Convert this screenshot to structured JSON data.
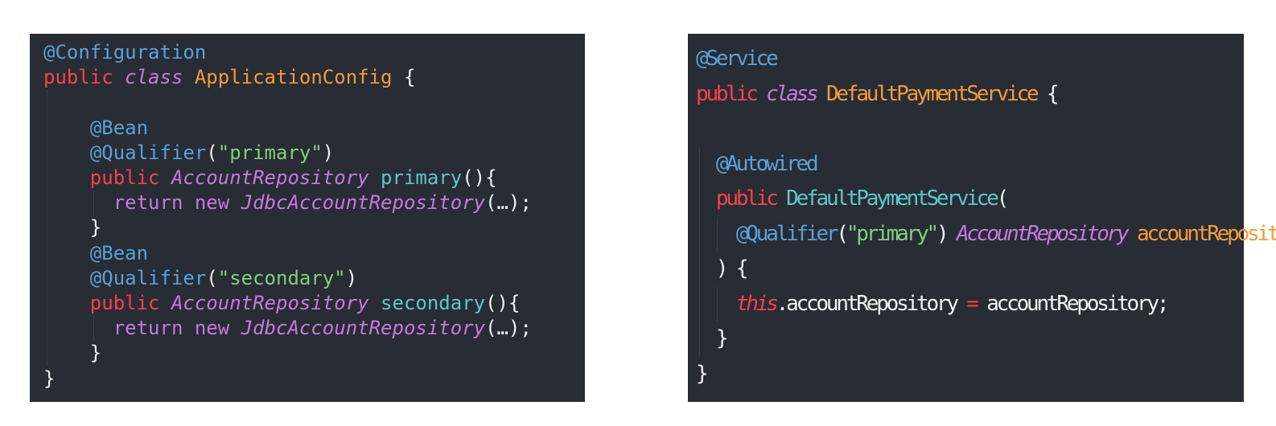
{
  "left_snippet": {
    "lines": [
      [
        {
          "t": "@Configuration",
          "c": "ann"
        }
      ],
      [
        {
          "t": "public",
          "c": "kw"
        },
        {
          "t": " ",
          "c": "plain"
        },
        {
          "t": "class",
          "c": "mod"
        },
        {
          "t": " ",
          "c": "plain"
        },
        {
          "t": "ApplicationConfig",
          "c": "cls"
        },
        {
          "t": " {",
          "c": "plain"
        }
      ],
      [],
      [
        {
          "t": "    ",
          "c": "plain"
        },
        {
          "t": "@Bean",
          "c": "ann"
        }
      ],
      [
        {
          "t": "    ",
          "c": "plain"
        },
        {
          "t": "@Qualifier",
          "c": "ann"
        },
        {
          "t": "(",
          "c": "plain"
        },
        {
          "t": "\"primary\"",
          "c": "str"
        },
        {
          "t": ")",
          "c": "plain"
        }
      ],
      [
        {
          "t": "    ",
          "c": "plain"
        },
        {
          "t": "public",
          "c": "kw"
        },
        {
          "t": " ",
          "c": "plain"
        },
        {
          "t": "AccountRepository",
          "c": "ty"
        },
        {
          "t": " ",
          "c": "plain"
        },
        {
          "t": "primary",
          "c": "fn"
        },
        {
          "t": "(){",
          "c": "plain"
        }
      ],
      [
        {
          "t": "      ",
          "c": "plain"
        },
        {
          "t": "return new",
          "c": "ret"
        },
        {
          "t": " ",
          "c": "plain"
        },
        {
          "t": "JdbcAccountRepository",
          "c": "ty"
        },
        {
          "t": "(…);",
          "c": "plain"
        }
      ],
      [
        {
          "t": "    }",
          "c": "plain"
        }
      ],
      [
        {
          "t": "    ",
          "c": "plain"
        },
        {
          "t": "@Bean",
          "c": "ann"
        }
      ],
      [
        {
          "t": "    ",
          "c": "plain"
        },
        {
          "t": "@Qualifier",
          "c": "ann"
        },
        {
          "t": "(",
          "c": "plain"
        },
        {
          "t": "\"secondary\"",
          "c": "str"
        },
        {
          "t": ")",
          "c": "plain"
        }
      ],
      [
        {
          "t": "    ",
          "c": "plain"
        },
        {
          "t": "public",
          "c": "kw"
        },
        {
          "t": " ",
          "c": "plain"
        },
        {
          "t": "AccountRepository",
          "c": "ty"
        },
        {
          "t": " ",
          "c": "plain"
        },
        {
          "t": "secondary",
          "c": "fn"
        },
        {
          "t": "(){",
          "c": "plain"
        }
      ],
      [
        {
          "t": "      ",
          "c": "plain"
        },
        {
          "t": "return new",
          "c": "ret"
        },
        {
          "t": " ",
          "c": "plain"
        },
        {
          "t": "JdbcAccountRepository",
          "c": "ty"
        },
        {
          "t": "(…);",
          "c": "plain"
        }
      ],
      [
        {
          "t": "    }",
          "c": "plain"
        }
      ],
      [
        {
          "t": "}",
          "c": "plain"
        }
      ]
    ]
  },
  "right_snippet": {
    "lines": [
      [
        {
          "t": "@Service",
          "c": "ann"
        }
      ],
      [
        {
          "t": "public",
          "c": "kw"
        },
        {
          "t": " ",
          "c": "plain"
        },
        {
          "t": "class",
          "c": "mod"
        },
        {
          "t": " ",
          "c": "plain"
        },
        {
          "t": "DefaultPaymentService",
          "c": "cls"
        },
        {
          "t": " {",
          "c": "plain"
        }
      ],
      [],
      [
        {
          "t": "  ",
          "c": "plain"
        },
        {
          "t": "@Autowired",
          "c": "ann"
        }
      ],
      [
        {
          "t": "  ",
          "c": "plain"
        },
        {
          "t": "public",
          "c": "kw"
        },
        {
          "t": " ",
          "c": "plain"
        },
        {
          "t": "DefaultPaymentService",
          "c": "fn"
        },
        {
          "t": "(",
          "c": "plain"
        }
      ],
      [
        {
          "t": "    ",
          "c": "plain"
        },
        {
          "t": "@Qualifier",
          "c": "ann"
        },
        {
          "t": "(",
          "c": "plain"
        },
        {
          "t": "\"primary\"",
          "c": "str"
        },
        {
          "t": ") ",
          "c": "plain"
        },
        {
          "t": "AccountRepository",
          "c": "ty"
        },
        {
          "t": " ",
          "c": "plain"
        },
        {
          "t": "accountRepository",
          "c": "param"
        }
      ],
      [
        {
          "t": "  ) {",
          "c": "plain"
        }
      ],
      [
        {
          "t": "    ",
          "c": "plain"
        },
        {
          "t": "this",
          "c": "thisk"
        },
        {
          "t": ".accountRepository ",
          "c": "plain"
        },
        {
          "t": "=",
          "c": "op"
        },
        {
          "t": " accountRepository;",
          "c": "plain"
        }
      ],
      [
        {
          "t": "  }",
          "c": "plain"
        }
      ],
      [
        {
          "t": "}",
          "c": "plain"
        }
      ]
    ]
  }
}
